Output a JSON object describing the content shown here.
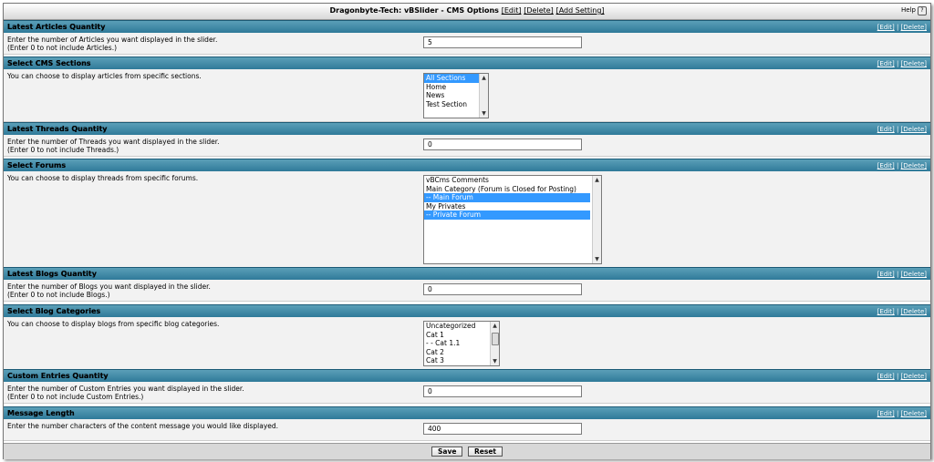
{
  "header": {
    "title": "Dragonbyte-Tech: vBSlider - CMS Options",
    "edit": "[Edit]",
    "delete": "[Delete]",
    "add_setting": "[Add Setting]",
    "help": "Help"
  },
  "common": {
    "edit": "[Edit]",
    "delete": "[Delete]",
    "sep": " | "
  },
  "sections": {
    "articles": {
      "title": "Latest Articles Quantity",
      "desc1": "Enter the number of Articles you want displayed in the slider.",
      "desc2": "(Enter 0 to not include Articles.)",
      "value": "5"
    },
    "cms_sections": {
      "title": "Select CMS Sections",
      "desc1": "You can choose to display articles from specific sections.",
      "options": [
        "All Sections",
        "Home",
        "News",
        "Test Section"
      ],
      "selected": [
        "All Sections"
      ]
    },
    "threads": {
      "title": "Latest Threads Quantity",
      "desc1": "Enter the number of Threads you want displayed in the slider.",
      "desc2": "(Enter 0 to not include Threads.)",
      "value": "0"
    },
    "forums": {
      "title": "Select Forums",
      "desc1": "You can choose to display threads from specific forums.",
      "options": [
        "vBCms Comments",
        "Main Category (Forum is Closed for Posting)",
        "-- Main Forum",
        "My Privates",
        "-- Private Forum"
      ],
      "selected": [
        "-- Main Forum",
        "-- Private Forum"
      ]
    },
    "blogs": {
      "title": "Latest Blogs Quantity",
      "desc1": "Enter the number of Blogs you want displayed in the slider.",
      "desc2": "(Enter 0 to not include Blogs.)",
      "value": "0"
    },
    "blog_categories": {
      "title": "Select Blog Categories",
      "desc1": "You can choose to display blogs from specific blog categories.",
      "options": [
        "Uncategorized",
        "Cat 1",
        "- - Cat 1.1",
        "Cat 2",
        "Cat 3"
      ],
      "selected": []
    },
    "custom": {
      "title": "Custom Entries Quantity",
      "desc1": "Enter the number of Custom Entries you want displayed in the slider.",
      "desc2": "(Enter 0 to not include Custom Entries.)",
      "value": "0"
    },
    "message_length": {
      "title": "Message Length",
      "desc1": "Enter the number characters of the content message you would like displayed.",
      "value": "400"
    }
  },
  "footer": {
    "save": "Save",
    "reset": "Reset"
  }
}
